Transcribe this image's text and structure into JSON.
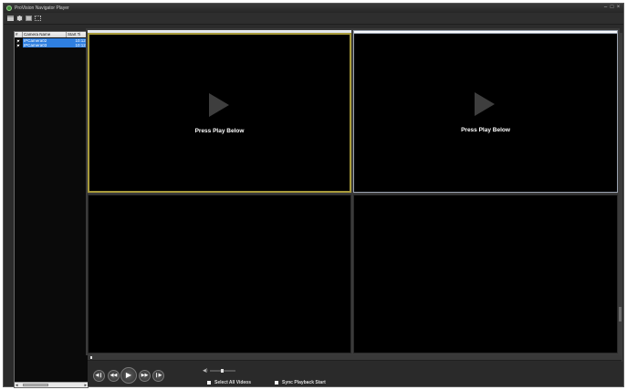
{
  "window": {
    "title": "ProVision Navigator Player",
    "controls": [
      "–",
      "□",
      "×"
    ]
  },
  "toolbar": {
    "icons": [
      "folder-icon",
      "film-icon",
      "save-icon",
      "expand-icon"
    ]
  },
  "camera_list": {
    "columns": [
      "#",
      "Camera Name",
      "Start Ti"
    ],
    "rows": [
      {
        "checked": true,
        "name": "IPCamera02",
        "start": "10:12:"
      },
      {
        "checked": true,
        "name": "IPCamera03",
        "start": "10:12:"
      }
    ]
  },
  "video_grid": {
    "tiles": [
      {
        "placeholder": "Press Play Below"
      },
      {
        "placeholder": "Press Play Below"
      },
      {
        "placeholder": ""
      },
      {
        "placeholder": ""
      }
    ]
  },
  "playback": {
    "buttons": {
      "step_back": "◀❙",
      "rewind": "◀◀",
      "play": "▶",
      "fast_forward": "▶▶",
      "step_forward": "❙▶"
    },
    "volume_icon": "◀)",
    "options": {
      "select_all_label": "Select All Videos",
      "sync_label": "Sync Playback Start"
    }
  },
  "colors": {
    "selection": "#2f7fe0",
    "active_tile_border": "#a89a3a",
    "background": "#2b2b2b"
  }
}
